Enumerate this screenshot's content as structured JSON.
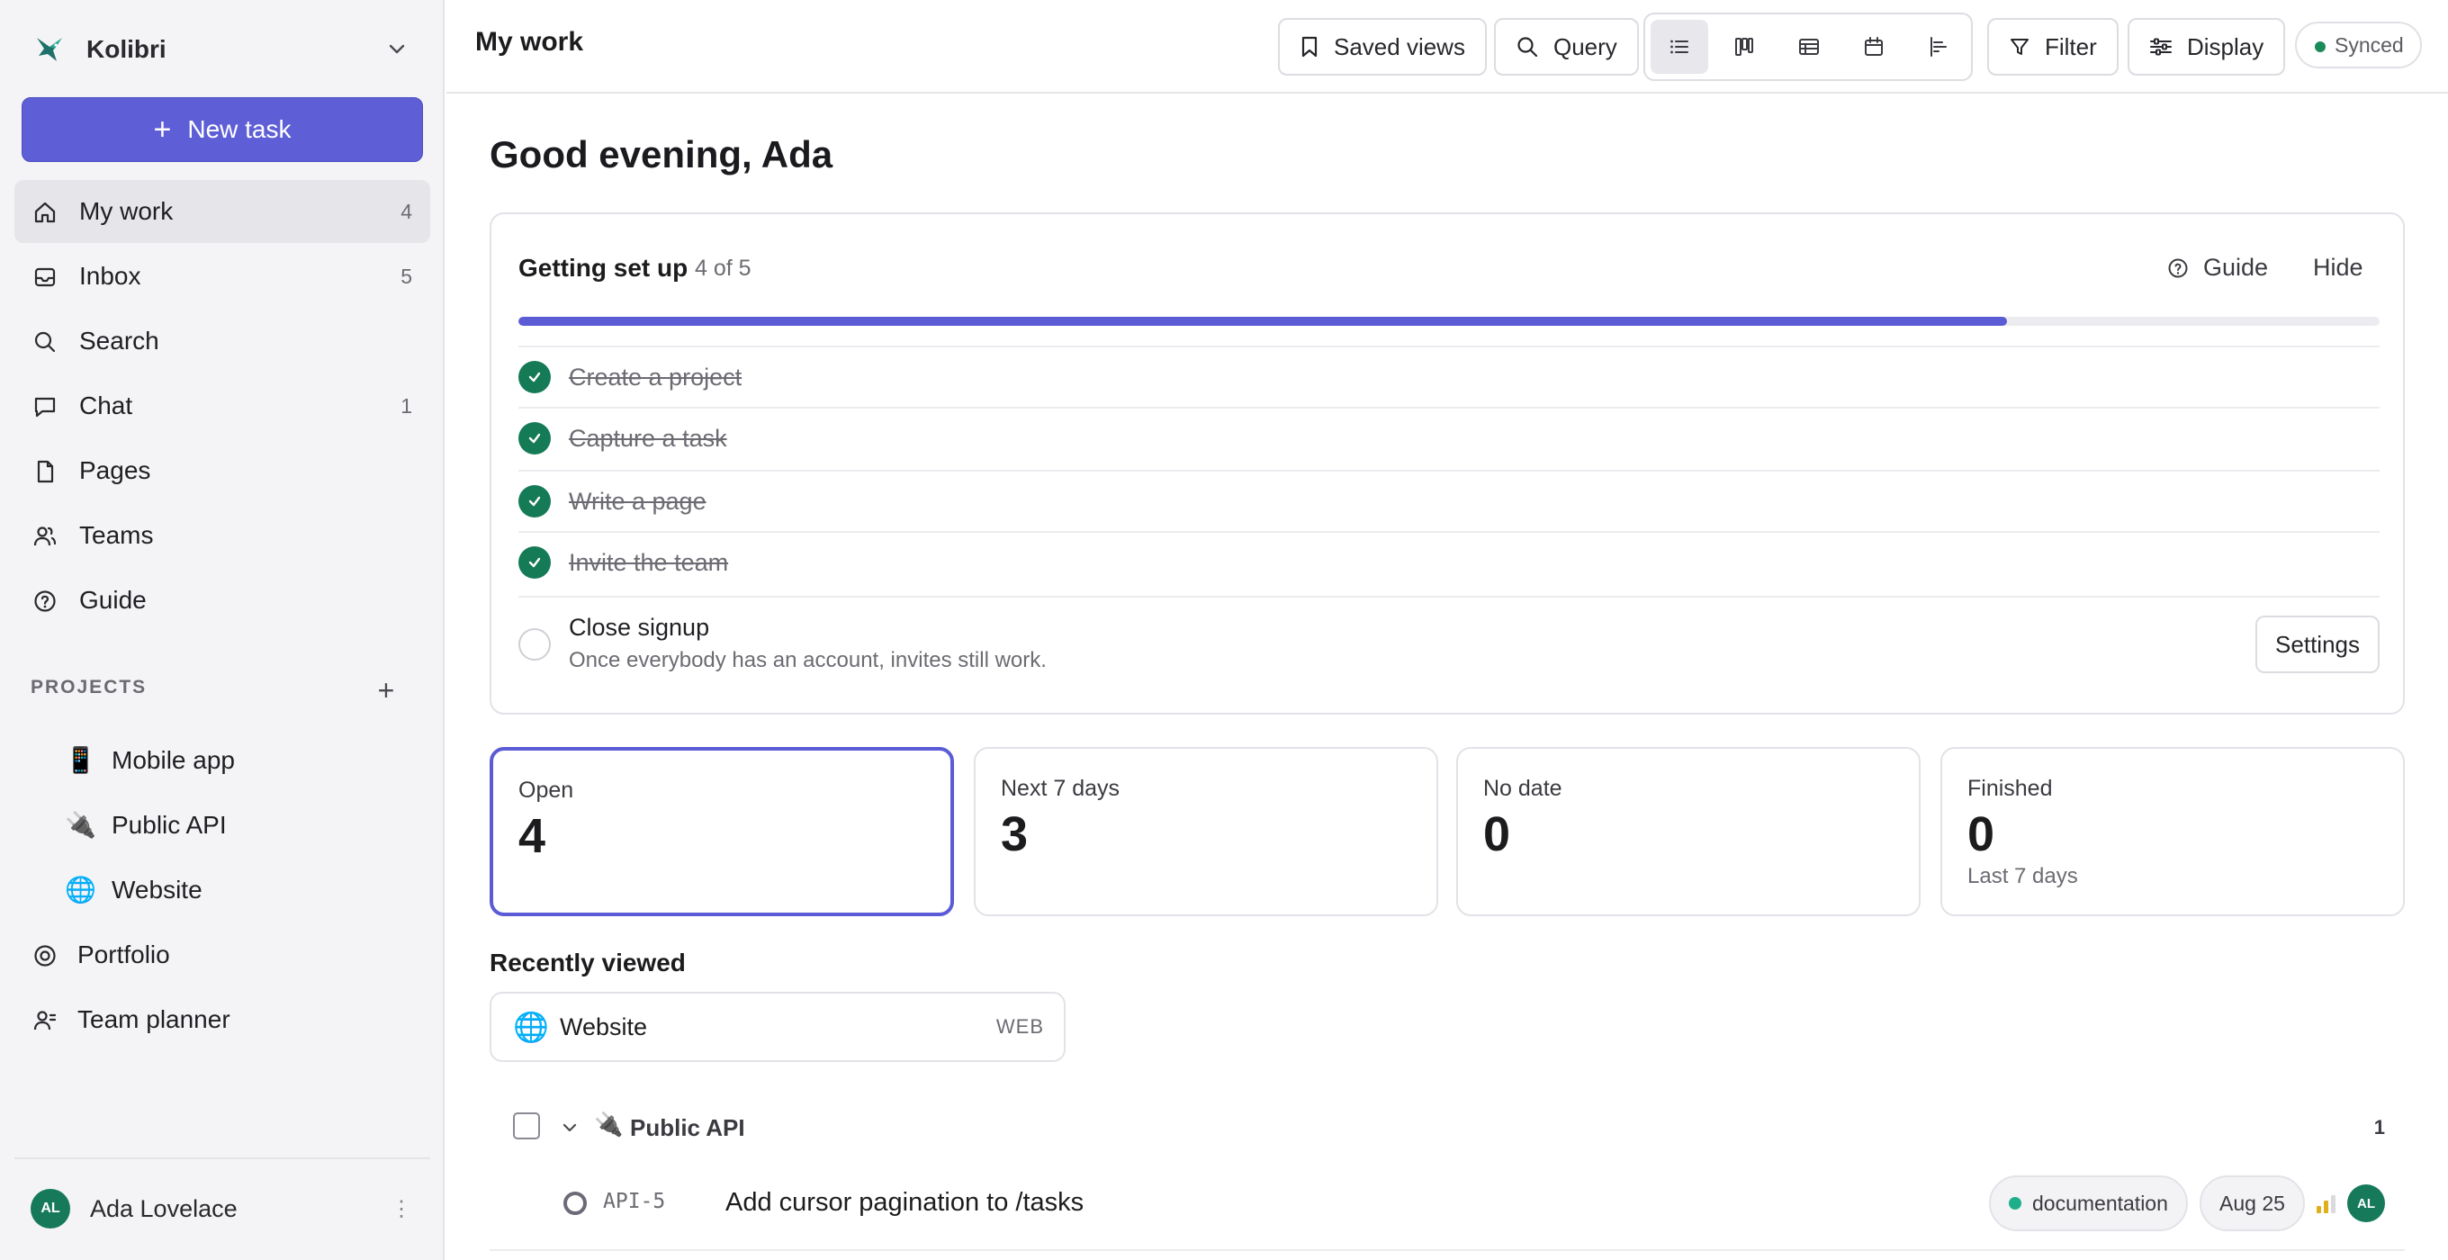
{
  "workspace": {
    "name": "Kolibri"
  },
  "sidebar": {
    "new_task_label": "New task",
    "nav": [
      {
        "label": "My work",
        "count": "4",
        "icon": "home-icon"
      },
      {
        "label": "Inbox",
        "count": "5",
        "icon": "inbox-icon"
      },
      {
        "label": "Search",
        "count": "",
        "icon": "search-icon"
      },
      {
        "label": "Chat",
        "count": "1",
        "icon": "chat-icon"
      },
      {
        "label": "Pages",
        "count": "",
        "icon": "page-icon"
      },
      {
        "label": "Teams",
        "count": "",
        "icon": "team-icon"
      },
      {
        "label": "Guide",
        "count": "",
        "icon": "help-icon"
      }
    ],
    "projects_heading": "PROJECTS",
    "projects": [
      {
        "emoji": "📱",
        "label": "Mobile app"
      },
      {
        "emoji": "🔌",
        "label": "Public API"
      },
      {
        "emoji": "🌐",
        "label": "Website"
      }
    ],
    "extra": [
      {
        "label": "Portfolio",
        "icon": "portfolio-icon"
      },
      {
        "label": "Team planner",
        "icon": "planner-icon"
      }
    ],
    "user": {
      "initials": "AL",
      "name": "Ada Lovelace"
    }
  },
  "header": {
    "title": "My work",
    "saved_views": "Saved views",
    "query": "Query",
    "filter": "Filter",
    "display": "Display",
    "sync_status": "Synced"
  },
  "main": {
    "greeting": "Good evening, Ada",
    "setup": {
      "title": "Getting set up",
      "count": "4 of 5",
      "guide": "Guide",
      "hide": "Hide",
      "progress": 0.8,
      "steps_done": [
        "Create a project",
        "Capture a task",
        "Write a page",
        "Invite the team"
      ],
      "last_step": {
        "title": "Close signup",
        "subtitle": "Once everybody has an account, invites still work.",
        "button": "Settings"
      }
    },
    "stats": [
      {
        "label": "Open",
        "value": "4",
        "sub": ""
      },
      {
        "label": "Next 7 days",
        "value": "3",
        "sub": ""
      },
      {
        "label": "No date",
        "value": "0",
        "sub": ""
      },
      {
        "label": "Finished",
        "value": "0",
        "sub": "Last 7 days"
      }
    ],
    "recent_title": "Recently viewed",
    "recent": {
      "emoji": "🌐",
      "label": "Website",
      "key": "WEB"
    },
    "group": {
      "emoji": "🔌",
      "label": "Public API",
      "count": "1"
    },
    "issue": {
      "key": "API-5",
      "title": "Add cursor pagination to /tasks",
      "label": "documentation",
      "due": "Aug 25",
      "assignee": "AL"
    }
  }
}
